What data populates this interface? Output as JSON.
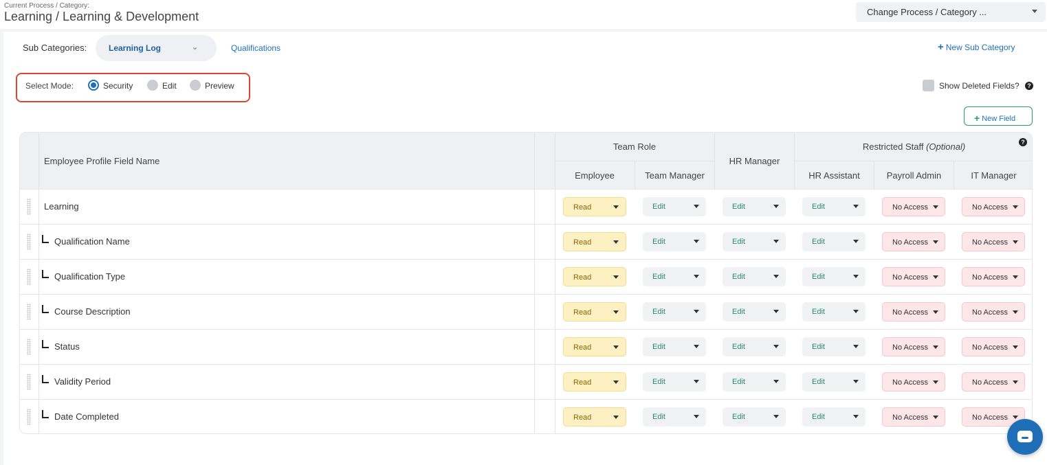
{
  "header": {
    "crumb_label": "Current Process / Category:",
    "crumb_title": "Learning / Learning & Development",
    "change_select": "Change Process / Category ..."
  },
  "subcategories": {
    "label": "Sub Categories:",
    "active": "Learning Log",
    "other": "Qualifications",
    "new_label": "New Sub Category"
  },
  "mode": {
    "label": "Select Mode:",
    "options": [
      "Security",
      "Edit",
      "Preview"
    ],
    "selected": "Security"
  },
  "show_deleted_label": "Show Deleted Fields?",
  "help_glyph": "?",
  "new_field_label": "New Field",
  "plus_glyph": "+",
  "table": {
    "field_col": "Employee Profile Field Name",
    "groups": {
      "team_role": "Team Role",
      "hr_manager": "HR Manager",
      "restricted": "Restricted Staff",
      "restricted_note": "(Optional)"
    },
    "columns": [
      "Employee",
      "Team Manager",
      "HR Assistant",
      "Payroll Admin",
      "IT Manager"
    ],
    "rows": [
      {
        "name": "Learning",
        "child": false,
        "perms": [
          "Read",
          "Edit",
          "Edit",
          "Edit",
          "No Access",
          "No Access"
        ]
      },
      {
        "name": "Qualification Name",
        "child": true,
        "perms": [
          "Read",
          "Edit",
          "Edit",
          "Edit",
          "No Access",
          "No Access"
        ]
      },
      {
        "name": "Qualification Type",
        "child": true,
        "perms": [
          "Read",
          "Edit",
          "Edit",
          "Edit",
          "No Access",
          "No Access"
        ]
      },
      {
        "name": "Course Description",
        "child": true,
        "perms": [
          "Read",
          "Edit",
          "Edit",
          "Edit",
          "No Access",
          "No Access"
        ]
      },
      {
        "name": "Status",
        "child": true,
        "perms": [
          "Read",
          "Edit",
          "Edit",
          "Edit",
          "No Access",
          "No Access"
        ]
      },
      {
        "name": "Validity Period",
        "child": true,
        "perms": [
          "Read",
          "Edit",
          "Edit",
          "Edit",
          "No Access",
          "No Access"
        ]
      },
      {
        "name": "Date Completed",
        "child": true,
        "perms": [
          "Read",
          "Edit",
          "Edit",
          "Edit",
          "No Access",
          "No Access"
        ]
      }
    ]
  },
  "icons": {
    "chat": "chat-bubble-icon",
    "drag": "drag-handle-icon",
    "hierarchy": "child-indent-icon"
  },
  "colors": {
    "accent": "#1f6fb8",
    "read": "#fdf1c4",
    "no_access": "#fde6e8",
    "highlight_box": "#d9472f"
  }
}
